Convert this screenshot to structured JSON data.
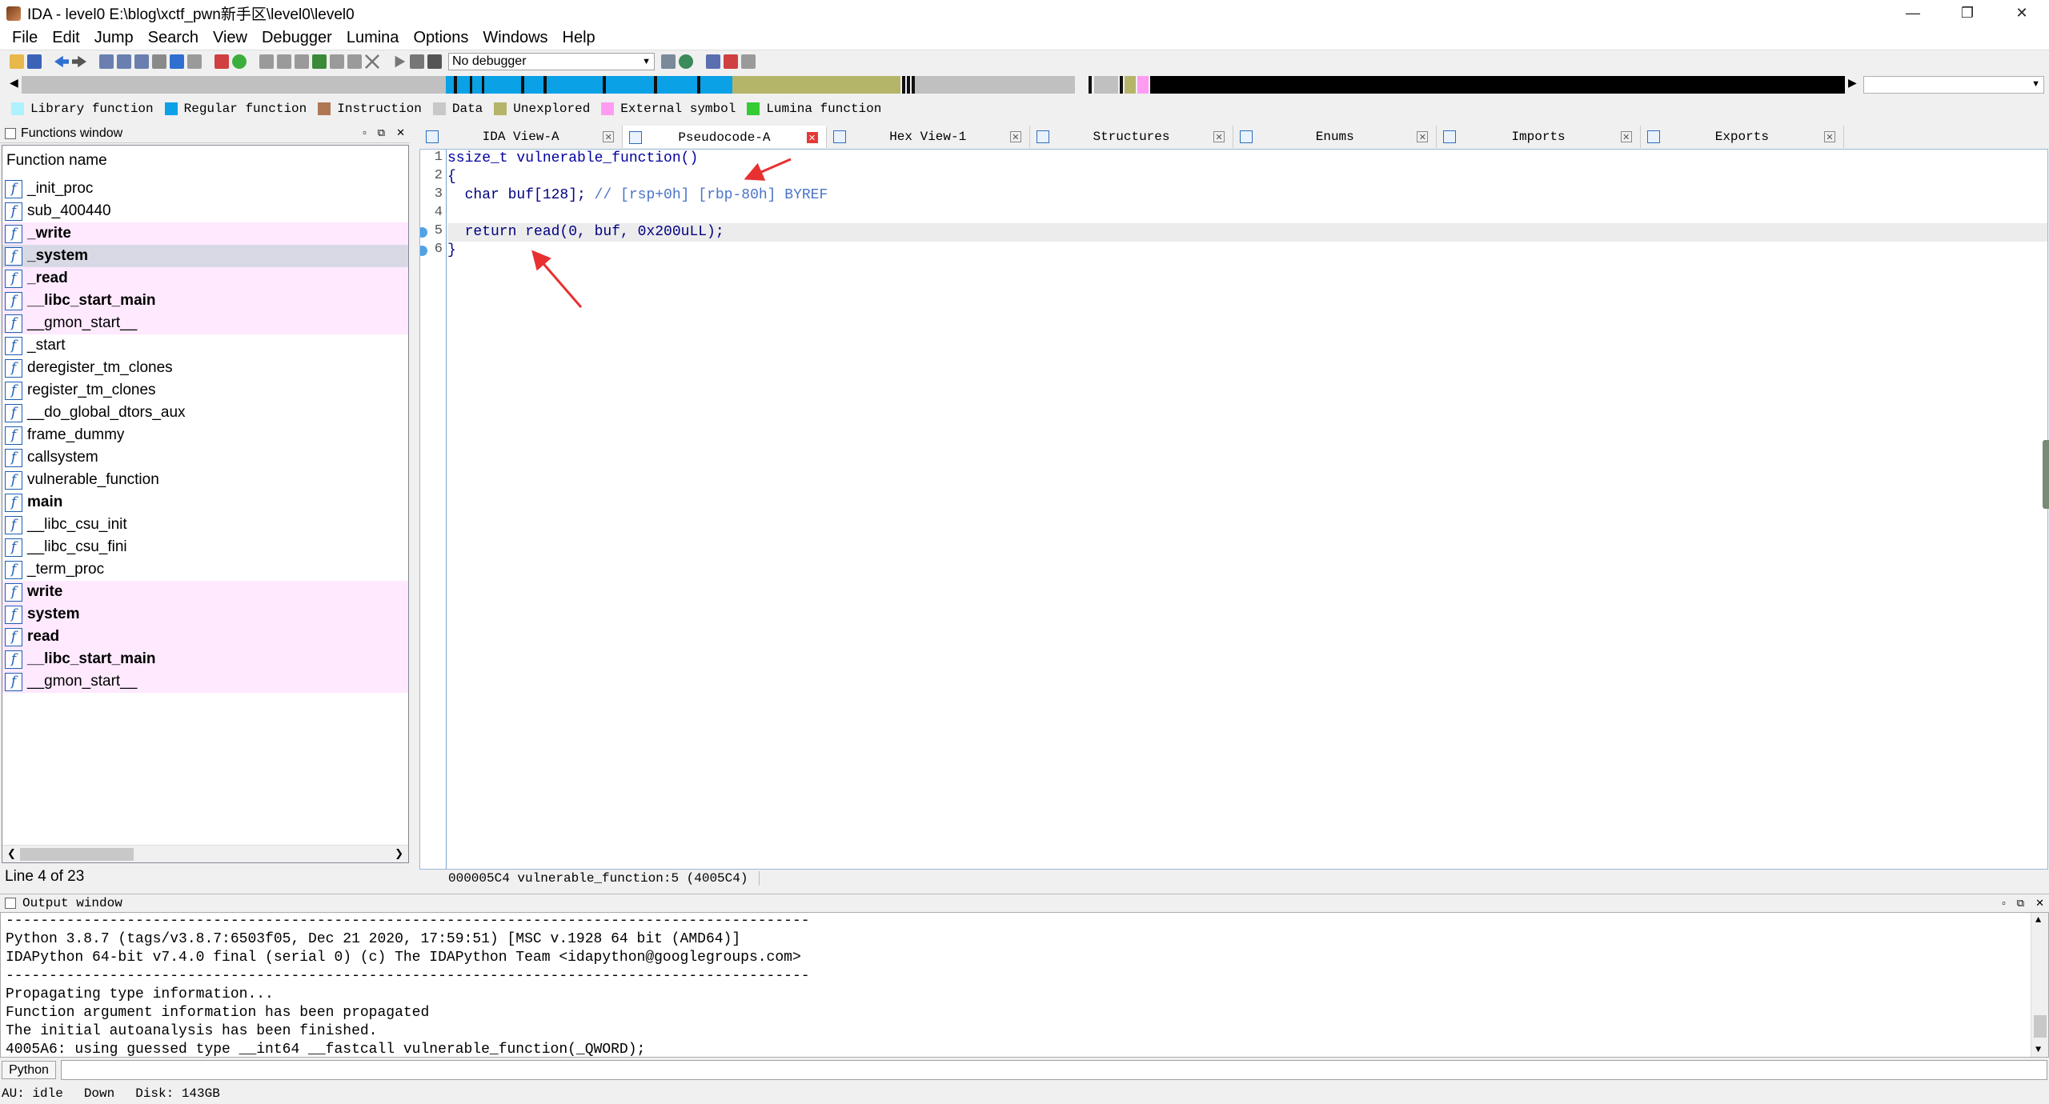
{
  "window": {
    "title": "IDA - level0 E:\\blog\\xctf_pwn新手区\\level0\\level0",
    "minimize": "—",
    "restore": "❐",
    "close": "✕"
  },
  "menu": [
    "File",
    "Edit",
    "Jump",
    "Search",
    "View",
    "Debugger",
    "Lumina",
    "Options",
    "Windows",
    "Help"
  ],
  "toolbar": {
    "debugger_select": "No debugger"
  },
  "legend": [
    {
      "label": "Library function",
      "color": "#aef2ff"
    },
    {
      "label": "Regular function",
      "color": "#0aa1e6"
    },
    {
      "label": "Instruction",
      "color": "#b07755"
    },
    {
      "label": "Data",
      "color": "#c8c8c8"
    },
    {
      "label": "Unexplored",
      "color": "#b5b56a"
    },
    {
      "label": "External symbol",
      "color": "#ff9cf2"
    },
    {
      "label": "Lumina function",
      "color": "#33cc33"
    }
  ],
  "functions_window": {
    "title": "Functions window",
    "column": "Function name",
    "items": [
      {
        "name": "_init_proc",
        "style": "normal"
      },
      {
        "name": "sub_400440",
        "style": "normal"
      },
      {
        "name": "_write",
        "style": "extern"
      },
      {
        "name": "_system",
        "style": "extern-selected"
      },
      {
        "name": "_read",
        "style": "extern"
      },
      {
        "name": "__libc_start_main",
        "style": "extern"
      },
      {
        "name": "__gmon_start__",
        "style": "extern-light"
      },
      {
        "name": "_start",
        "style": "normal"
      },
      {
        "name": "deregister_tm_clones",
        "style": "normal"
      },
      {
        "name": "register_tm_clones",
        "style": "normal"
      },
      {
        "name": "__do_global_dtors_aux",
        "style": "normal"
      },
      {
        "name": "frame_dummy",
        "style": "normal"
      },
      {
        "name": "callsystem",
        "style": "normal"
      },
      {
        "name": "vulnerable_function",
        "style": "normal"
      },
      {
        "name": "main",
        "style": "bold"
      },
      {
        "name": "__libc_csu_init",
        "style": "normal"
      },
      {
        "name": "__libc_csu_fini",
        "style": "normal"
      },
      {
        "name": "_term_proc",
        "style": "normal"
      },
      {
        "name": "write",
        "style": "extern"
      },
      {
        "name": "system",
        "style": "extern"
      },
      {
        "name": "read",
        "style": "extern"
      },
      {
        "name": "__libc_start_main",
        "style": "extern"
      },
      {
        "name": "__gmon_start__",
        "style": "extern-light"
      }
    ],
    "status": "Line 4 of 23"
  },
  "tabs": [
    {
      "label": "IDA View-A",
      "active": false
    },
    {
      "label": "Pseudocode-A",
      "active": true
    },
    {
      "label": "Hex View-1",
      "active": false
    },
    {
      "label": "Structures",
      "active": false
    },
    {
      "label": "Enums",
      "active": false
    },
    {
      "label": "Imports",
      "active": false
    },
    {
      "label": "Exports",
      "active": false
    }
  ],
  "pseudocode": {
    "lines": [
      {
        "num": "1",
        "text": "ssize_t vulnerable_function()"
      },
      {
        "num": "2",
        "text": "{"
      },
      {
        "num": "3",
        "decl": "  char buf[128]; ",
        "comment": "// [rsp+0h] [rbp-80h] BYREF"
      },
      {
        "num": "4",
        "text": ""
      },
      {
        "num": "5",
        "text": "  return read(0, buf, 0x200uLL);"
      },
      {
        "num": "6",
        "text": "}"
      }
    ],
    "status": "000005C4 vulnerable_function:5 (4005C4)"
  },
  "output_window": {
    "title": "Output window",
    "lines": [
      "---------------------------------------------------------------------------------------------",
      "Python 3.8.7 (tags/v3.8.7:6503f05, Dec 21 2020, 17:59:51) [MSC v.1928 64 bit (AMD64)]",
      "IDAPython 64-bit v7.4.0 final (serial 0) (c) The IDAPython Team <idapython@googlegroups.com>",
      "---------------------------------------------------------------------------------------------",
      "Propagating type information...",
      "Function argument information has been propagated",
      "The initial autoanalysis has been finished.",
      "4005A6: using guessed type __int64 __fastcall vulnerable_function(_QWORD);"
    ]
  },
  "python_button": "Python",
  "statusbar": {
    "au": "AU:  idle",
    "direction": "Down",
    "disk": "Disk: 143GB"
  }
}
